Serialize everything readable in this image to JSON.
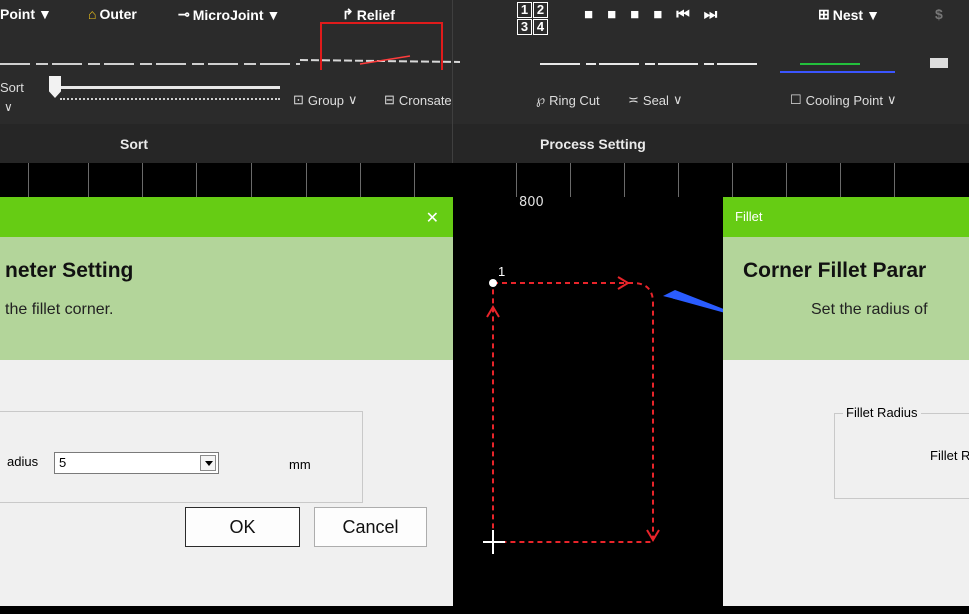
{
  "ribbon": {
    "row1": {
      "point": "Point",
      "outer": "Outer",
      "microjoint": "MicroJoint",
      "relief": "Relief",
      "nest": "Nest",
      "order_glyph": [
        "1",
        "2",
        "3",
        "4"
      ]
    },
    "row3": {
      "group": "Group",
      "compensate": "Cronsate",
      "ring_cut": "Ring Cut",
      "seal": "Seal",
      "cooling_point": "Cooling Point"
    },
    "sort_label": "Sort",
    "sections": {
      "sort": "Sort",
      "process_setting": "Process Setting"
    }
  },
  "canvas": {
    "ruler_label": "800",
    "start_point_label": "1",
    "accent": "#e8242a",
    "arrow_color": "#2a5cff"
  },
  "dialog_left": {
    "title_partial": "neter Setting",
    "subtitle_partial": "the fillet corner.",
    "field_label_partial": "adius",
    "radius_value": "5",
    "unit": "mm",
    "ok_label": "OK",
    "cancel_label": "Cancel",
    "close_glyph": "✕"
  },
  "dialog_right": {
    "window_title": "Fillet",
    "title_partial": "Corner Fillet Parar",
    "subtitle_partial": "Set the radius of",
    "group_label": "Fillet Radius",
    "field_label_partial": "Fillet R"
  },
  "colors": {
    "title_green": "#66cc14",
    "header_green": "#b3d59a",
    "ribbon_bg": "#2b2b2b"
  }
}
